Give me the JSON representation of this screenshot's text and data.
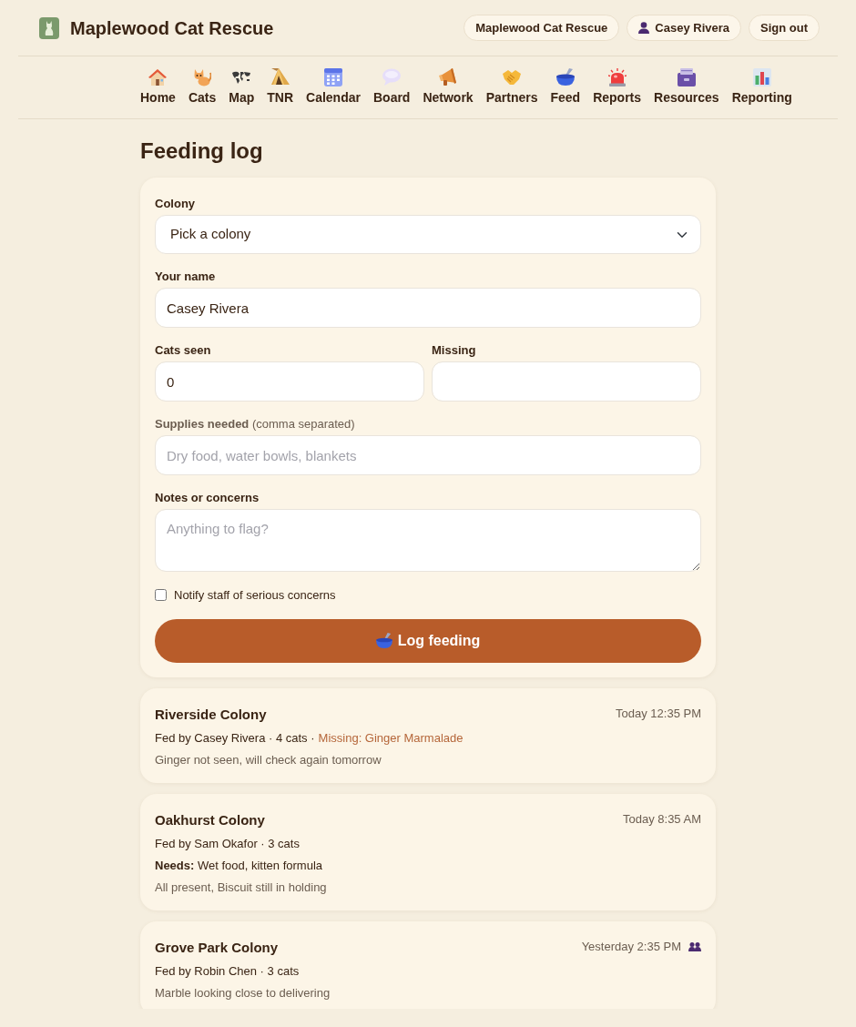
{
  "header": {
    "brand": "Maplewood Cat Rescue",
    "org_pill": "Maplewood Cat Rescue",
    "user": "Casey Rivera",
    "sign_out": "Sign out"
  },
  "nav": [
    {
      "label": "Home",
      "kind": "house"
    },
    {
      "label": "Cats",
      "kind": "cat"
    },
    {
      "label": "Map",
      "kind": "map"
    },
    {
      "label": "TNR",
      "kind": "tent"
    },
    {
      "label": "Calendar",
      "kind": "calendar"
    },
    {
      "label": "Board",
      "kind": "bubble"
    },
    {
      "label": "Network",
      "kind": "megaphone"
    },
    {
      "label": "Partners",
      "kind": "handshake"
    },
    {
      "label": "Feed",
      "kind": "bowl"
    },
    {
      "label": "Reports",
      "kind": "siren"
    },
    {
      "label": "Resources",
      "kind": "box"
    },
    {
      "label": "Reporting",
      "kind": "chart"
    }
  ],
  "page_title": "Feeding log",
  "form": {
    "colony": {
      "label": "Colony",
      "value": "Pick a colony"
    },
    "name": {
      "label": "Your name",
      "value": "Casey Rivera"
    },
    "cats_seen": {
      "label": "Cats seen",
      "value": "0"
    },
    "missing": {
      "label": "Missing"
    },
    "supplies": {
      "label": "**Supplies needed** (comma separated)",
      "placeholder": "Dry food, water bowls, blankets"
    },
    "notes": {
      "label": "Notes or concerns",
      "placeholder": "Anything to flag?"
    },
    "notify": {
      "label": "Notify staff of serious concerns",
      "checked": false
    },
    "submit": {
      "label": "Log feeding"
    }
  },
  "entries": [
    {
      "colony": "Riverside Colony",
      "time": "Today 12:35 PM",
      "people_icon": false,
      "meta": "Fed by Casey Rivera · 4 cats ·",
      "missing": "Missing: Ginger Marmalade",
      "note": "Ginger not seen, will check again tomorrow"
    },
    {
      "colony": "Oakhurst Colony",
      "time": "Today 8:35 AM",
      "people_icon": false,
      "meta": "Fed by Sam Okafor · 3 cats",
      "needs": "**Needs:** Wet food, kitten formula",
      "note": "All present, Biscuit still in holding"
    },
    {
      "colony": "Grove Park Colony",
      "time": "Yesterday 2:35 PM",
      "people_icon": true,
      "meta": "Fed by Robin Chen · 3 cats",
      "note": "Marble looking close to delivering"
    }
  ]
}
